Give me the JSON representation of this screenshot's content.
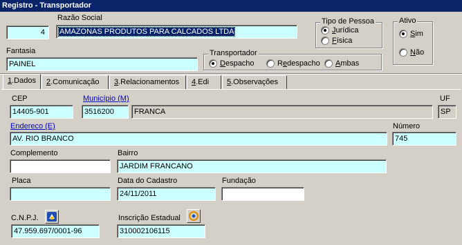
{
  "window": {
    "title": "Registro - Transportador"
  },
  "header": {
    "codigo": "4",
    "razao_social_label": "Razão Social",
    "razao_social_value": "AMAZONAS PRODUTOS PARA CALCADOS LTDA",
    "fantasia_label": "Fantasia",
    "fantasia_value": "PAINEL",
    "tipo_pessoa": {
      "title": "Tipo de Pessoa",
      "opt1_u": "J",
      "opt1_rest": "urídica",
      "opt2_u": "F",
      "opt2_rest": "ísica",
      "selected": "Jurídica"
    },
    "ativo": {
      "title": "Ativo",
      "opt1_u": "S",
      "opt1_rest": "im",
      "opt2_u": "N",
      "opt2_rest": "ão",
      "selected": "Sim"
    },
    "transportador": {
      "title": "Transportador",
      "opt1_u": "D",
      "opt1_rest": "espacho",
      "opt2_pre": "R",
      "opt2_u": "e",
      "opt2_rest": "despacho",
      "opt3_u": "A",
      "opt3_rest": "mbas",
      "selected": "Despacho"
    }
  },
  "tabs": [
    {
      "num": "1",
      "label": ".Dados"
    },
    {
      "num": "2",
      "label": ".Comunicação"
    },
    {
      "num": "3",
      "label": ".Relacionamentos"
    },
    {
      "num": "4",
      "label": ".Edi"
    },
    {
      "num": "5",
      "label": ".Observações"
    }
  ],
  "dados": {
    "cep_label": "CEP",
    "cep": "14405-901",
    "municipio_label": "Município (M)",
    "municipio_code": "3516200",
    "municipio_name": "FRANCA",
    "uf_label": "UF",
    "uf": "SP",
    "endereco_label": "Endereco (E)",
    "endereco": "AV. RIO BRANCO",
    "numero_label": "Número",
    "numero": "745",
    "complemento_label": "Complemento",
    "complemento": "",
    "bairro_label": "Bairro",
    "bairro": "JARDIM FRANCANO",
    "placa_label": "Placa",
    "placa": "",
    "data_cadastro_label": "Data do Cadastro",
    "data_cadastro": "24/11/2011",
    "fundacao_label": "Fundação",
    "fundacao": "",
    "cnpj_label": "C.N.P.J.",
    "cnpj": "47.959.697/0001-96",
    "ie_label": "Inscrição Estadual",
    "ie": "310002106115"
  },
  "icons": {
    "cnpj_lookup": "receita-federal-icon",
    "ie_lookup": "sintegra-icon"
  }
}
